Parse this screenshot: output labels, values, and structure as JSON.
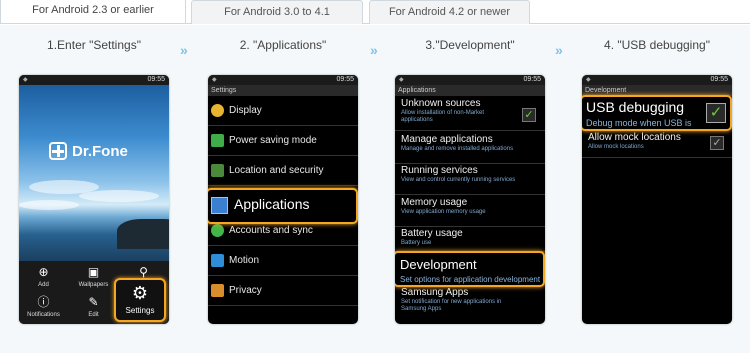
{
  "tabs": [
    {
      "label": "For Android 2.3 or earlier"
    },
    {
      "label": "For Android 3.0 to 4.1"
    },
    {
      "label": "For Android 4.2 or newer"
    }
  ],
  "steps": [
    {
      "label": "1.Enter \"Settings\""
    },
    {
      "label": "2. \"Applications\""
    },
    {
      "label": "3.\"Development\""
    },
    {
      "label": "4. \"USB debugging\""
    }
  ],
  "status_time": "09:55",
  "phone1": {
    "logo": "Dr.Fone",
    "dock": [
      "Add",
      "Wallpapers",
      "Notifications",
      "Edit"
    ],
    "settings_label": "Settings"
  },
  "phone2": {
    "title": "Settings",
    "items": [
      "Display",
      "Power saving mode",
      "Location and security",
      "Applications",
      "Accounts and sync",
      "Motion",
      "Privacy"
    ]
  },
  "phone3": {
    "title": "Applications",
    "items": [
      {
        "title": "Unknown sources",
        "sub": "Allow installation of non-Market applications"
      },
      {
        "title": "Manage applications",
        "sub": "Manage and remove installed applications"
      },
      {
        "title": "Running services",
        "sub": "View and control currently running services"
      },
      {
        "title": "Memory usage",
        "sub": "View application memory usage"
      },
      {
        "title": "Battery usage",
        "sub": "Battery use"
      },
      {
        "title": "Development",
        "sub": "Set options for application development"
      },
      {
        "title": "Samsung Apps",
        "sub": "Set notification for new applications in Samsung Apps"
      }
    ]
  },
  "phone4": {
    "title": "Development",
    "items": [
      {
        "title": "USB debugging",
        "sub": "Debug mode when USB is"
      },
      {
        "title": "Allow mock locations",
        "sub": "Allow mock locations"
      }
    ]
  },
  "colors": {
    "highlight": "#f5a623",
    "chevron": "#7ec3ea"
  }
}
